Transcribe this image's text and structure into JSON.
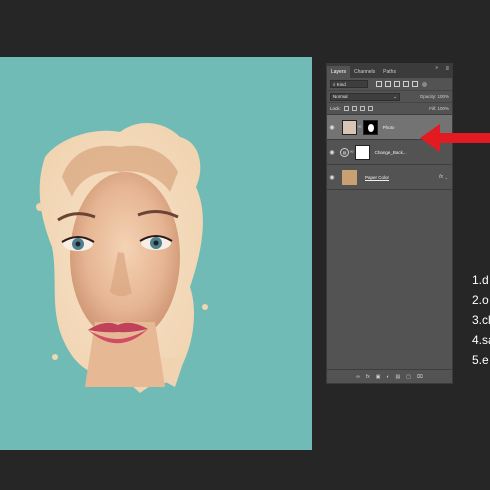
{
  "layers_panel": {
    "tabs": [
      "Layers",
      "Channels",
      "Paths"
    ],
    "collapse_icon": "double-chevron-icon",
    "menu_icon": "panel-menu-icon",
    "filter": {
      "kind_label": "⌕ Kind"
    },
    "blend_mode": "Normal",
    "opacity_label": "Opacity:",
    "opacity_value": "100%",
    "lock_label": "Lock:",
    "fill_label": "Fill:",
    "fill_value": "100%",
    "layers": [
      {
        "name": "Photo",
        "visible": true,
        "selected": true,
        "has_mask": true
      },
      {
        "name": "Change_Back...",
        "visible": true,
        "selected": false,
        "adjustment": true
      },
      {
        "name": "Paper Color",
        "visible": true,
        "selected": false,
        "fx": "fx"
      }
    ],
    "footer_icons": [
      "link-icon",
      "fx-icon",
      "mask-icon",
      "adjustment-icon",
      "folder-icon",
      "new-layer-icon",
      "trash-icon"
    ],
    "footer_labels": [
      "∞",
      "fx",
      "▣",
      "◐",
      "▤",
      "▢",
      "⌧"
    ]
  },
  "colors": {
    "canvas_bg": "#70bbb5",
    "paper_swatch": "#c9a074",
    "arrow": "#e21b23"
  },
  "steps": [
    "1.d",
    "2.o",
    "3.cl",
    "4.sa",
    "5.e"
  ]
}
